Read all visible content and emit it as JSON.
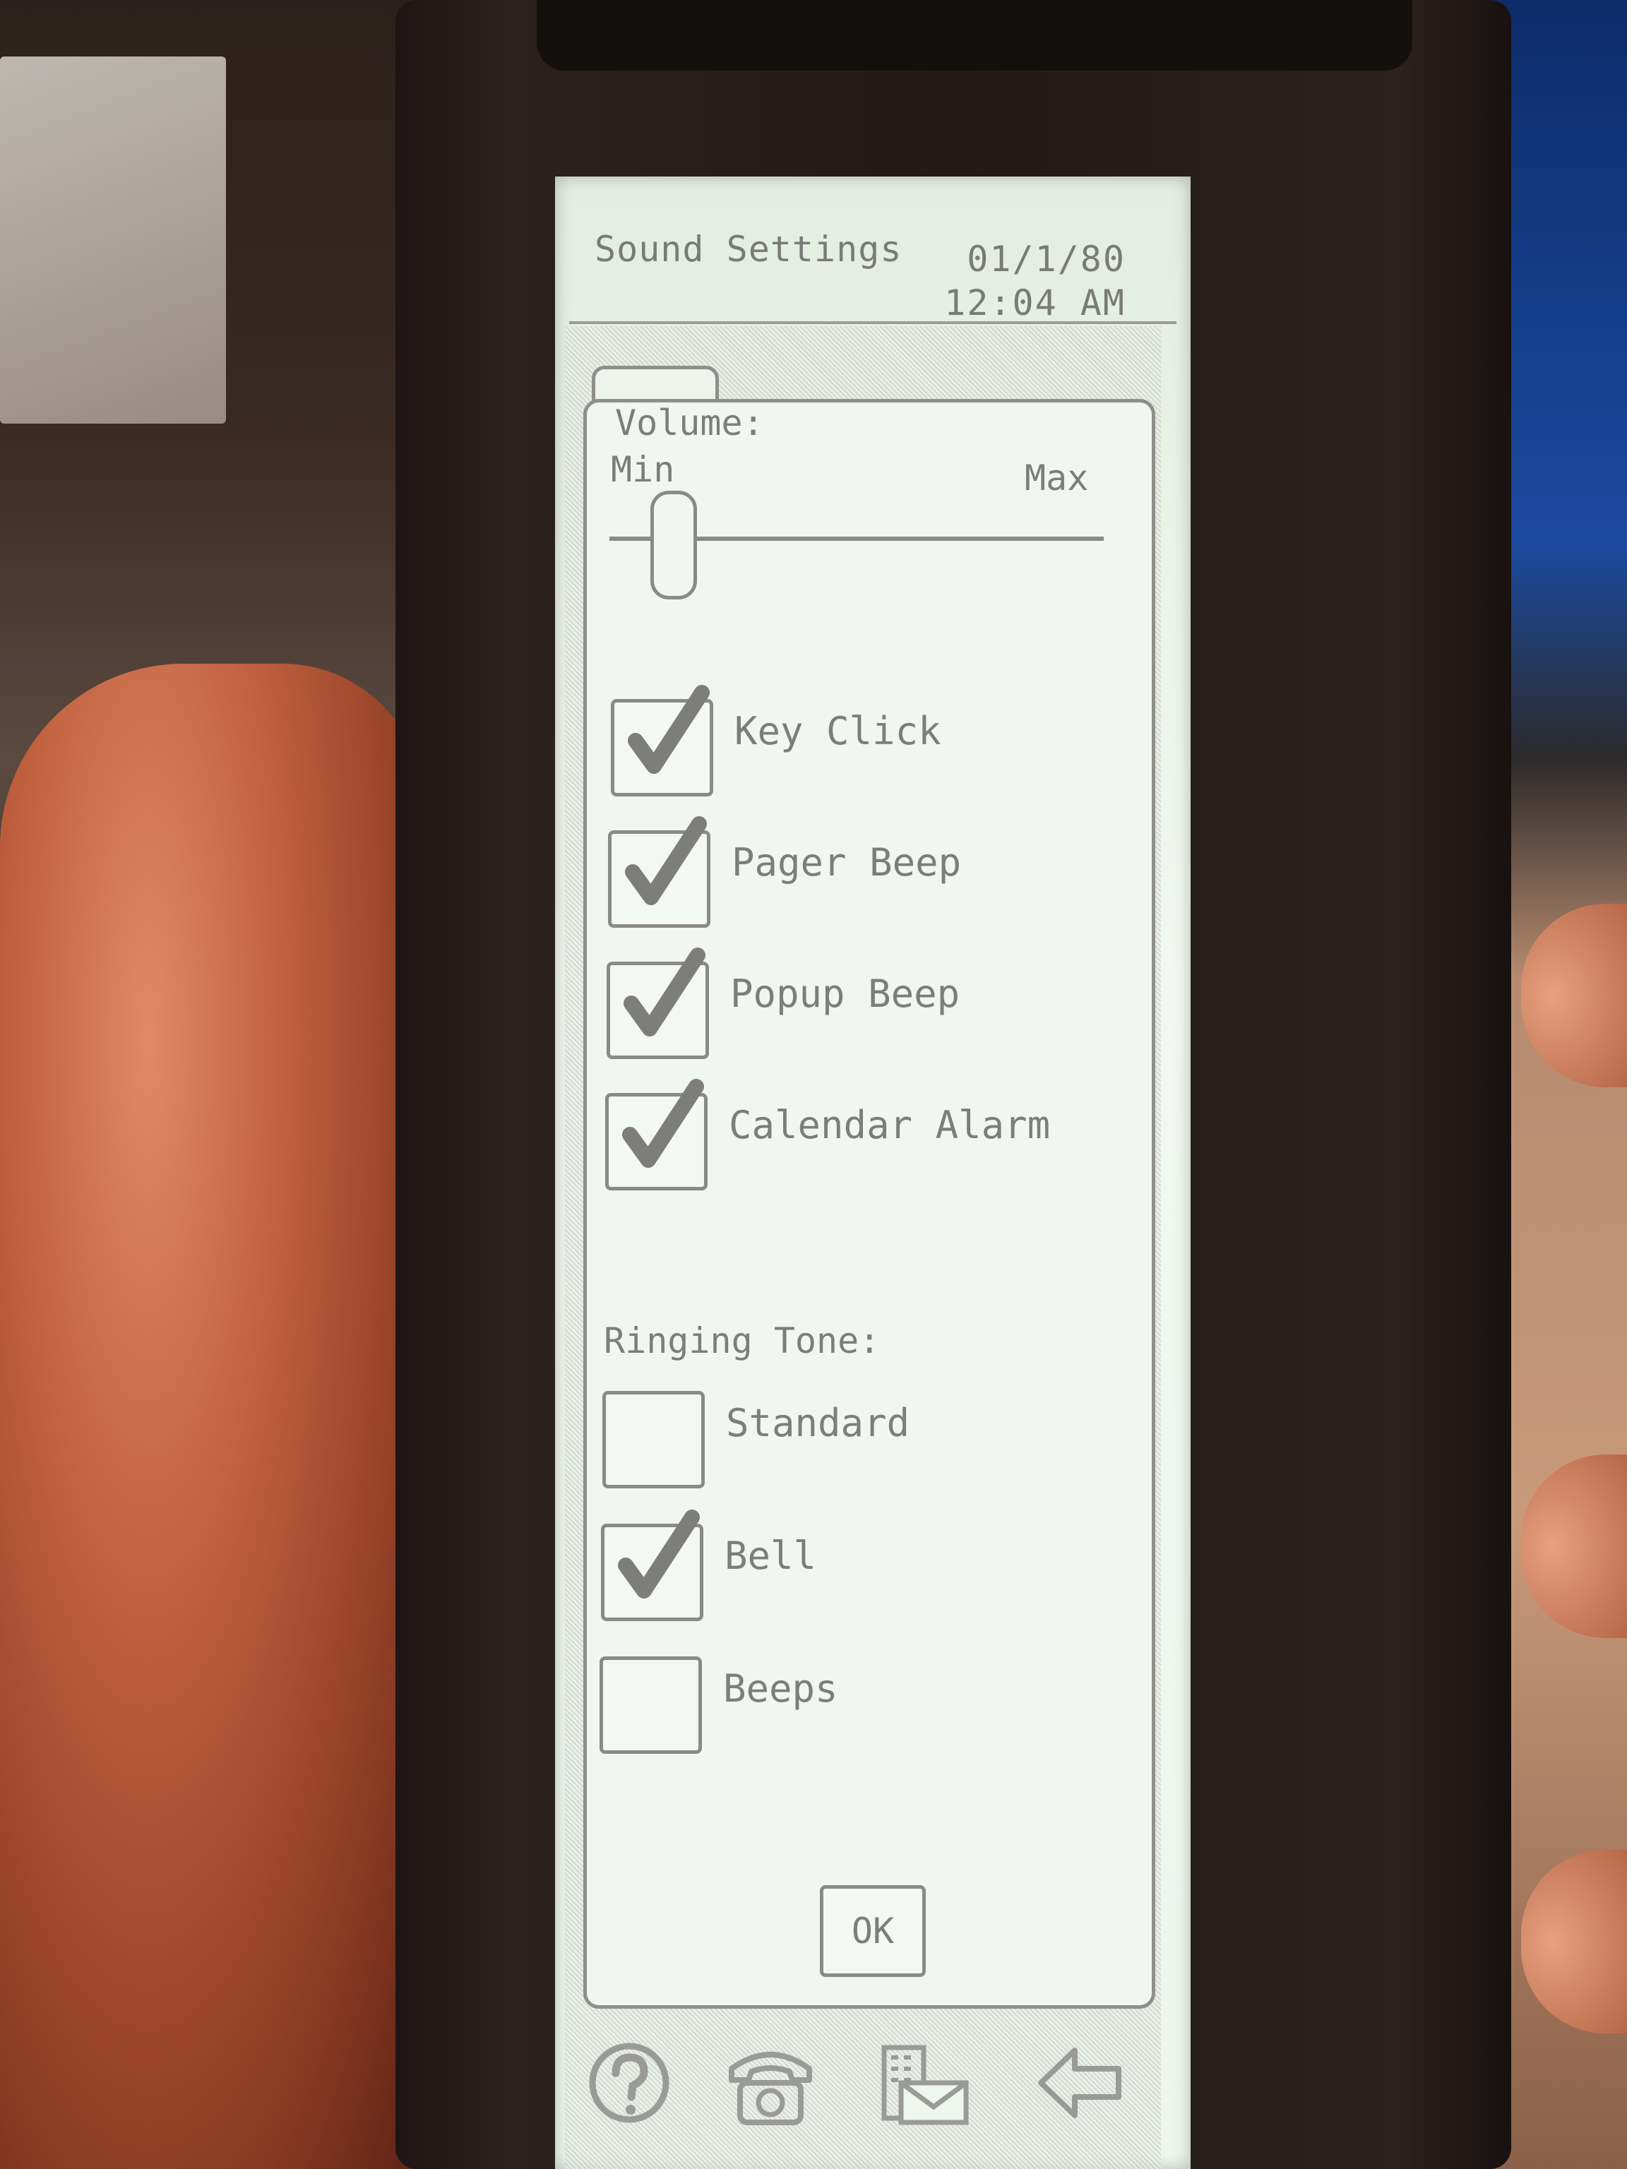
{
  "screen": {
    "title": "Sound Settings",
    "date": "01/1/80",
    "time": "12:04 AM"
  },
  "volume": {
    "label": "Volume:",
    "min_label": "Min",
    "max_label": "Max",
    "level": 0.13
  },
  "sound_options": [
    {
      "label": "Key Click",
      "checked": true
    },
    {
      "label": "Pager Beep",
      "checked": true
    },
    {
      "label": "Popup Beep",
      "checked": true
    },
    {
      "label": "Calendar Alarm",
      "checked": true
    }
  ],
  "ringing_tone": {
    "label": "Ringing Tone:",
    "options": [
      {
        "label": "Standard",
        "checked": false
      },
      {
        "label": "Bell",
        "checked": true
      },
      {
        "label": "Beeps",
        "checked": false
      }
    ]
  },
  "ok_button": {
    "label": "OK"
  },
  "bottom_bar": {
    "icons": [
      "help-icon",
      "phone-icon",
      "mail-icon",
      "back-arrow-icon"
    ]
  },
  "colors": {
    "lcd_background": "#eef6ee",
    "lcd_ink": "#7d7d7b",
    "device_body": "#231a18"
  }
}
